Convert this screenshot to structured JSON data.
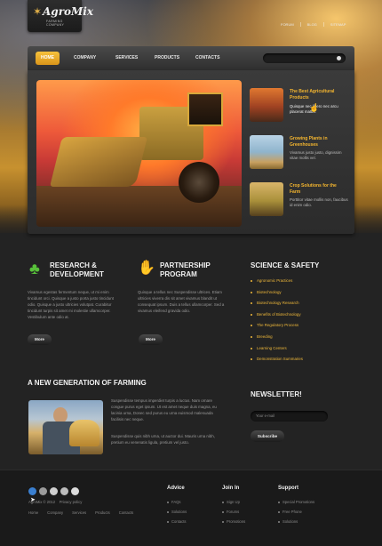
{
  "logo": {
    "title": "AgroMix",
    "subtitle": "FARMING COMPANY"
  },
  "top_links": [
    "FORUM",
    "BLOG",
    "SITEMAP"
  ],
  "nav": {
    "items": [
      "HOME",
      "COMPANY",
      "SERVICES",
      "PRODUCTS",
      "CONTACTS"
    ],
    "active": "HOME"
  },
  "slider": {
    "thumbs": [
      {
        "title": "The Best Agricultural Products",
        "text": "Quisque nec libero nec arcu placerat mattis."
      },
      {
        "title": "Growing Plants in Greenhouses",
        "text": "Vivamus justo justo, dignissim vitae mollis vel."
      },
      {
        "title": "Crop Solutions for the Farm",
        "text": "Porttitor vitae mollis non, faucibus id enim odio."
      }
    ]
  },
  "research": {
    "title_line1": "RESEARCH &",
    "title_line2": "DEVELOPMENT",
    "body": "Vivamus egestas fermentum neque, ut mi enim tincidunt orci. Quisque a justo porta justo tincidunt odio. Quisque a justo ultricies volutpat. Curabitur tincidunt turpis sit amet mi molestie ullamcorper. Vestibulum ante odio at.",
    "more_label": "More"
  },
  "partnership": {
    "title_line1": "PARTNERSHIP",
    "title_line2": "PROGRAM",
    "body": "Quisque a tellus nec Suspendisse ultrices. Etiam ultricies viverra dis sit amet vivamus blandit ut consequat ipsum. Duis a tellus ullamcorper. Sed a vivamus eleifend gravida odio.",
    "more_label": "More"
  },
  "science": {
    "title": "SCIENCE & SAFETY",
    "items": [
      "Agronomic Practices",
      "Biotechnology",
      "Biotechnology Research",
      "Benefits of Biotechnology",
      "The Regulatory Process",
      "Breeding",
      "Learning Centers",
      "Demonstration Summaries"
    ]
  },
  "generation": {
    "title": "A NEW GENERATION OF FARMING",
    "paragraph1": "Suspendisse tempus imperdiet turpis a luctus. Nam ornare congue purus eget ipsum. Ut est amet neque duis magna, eu lacinia urna, Donec sed purus eu urna euismod malesuada facilisis nec neque.",
    "paragraph2": "Suspendisse quis nibh urna, ut auctor dui. Mauris urna nibh, pretium eu venenatis ligula, pretium vel justo."
  },
  "newsletter": {
    "title": "NEWSLETTER!",
    "placeholder": "Your e-mail",
    "subscribe_label": "Subscribe"
  },
  "footer": {
    "copyright": "AgroMix © 2012",
    "privacy": "Privacy policy",
    "nav": [
      "Home",
      "Company",
      "Services",
      "Products",
      "Contacts"
    ],
    "columns": [
      {
        "title": "Advice",
        "items": [
          "FAQs",
          "Solutions",
          "Contacts"
        ]
      },
      {
        "title": "Join In",
        "items": [
          "Sign Up",
          "Forums",
          "Promotions"
        ]
      },
      {
        "title": "Support",
        "items": [
          "Special Promotions",
          "Free Phone",
          "Solutions"
        ]
      }
    ],
    "social_colors": [
      "#3a7fd0",
      "#9b9b9b",
      "#cfcfcf",
      "#bcbcbc",
      "#dcdcdc"
    ]
  },
  "colors": {
    "accent": "#f5b62f",
    "nav_active": "#e9a82c",
    "clover": "#58c13a"
  }
}
